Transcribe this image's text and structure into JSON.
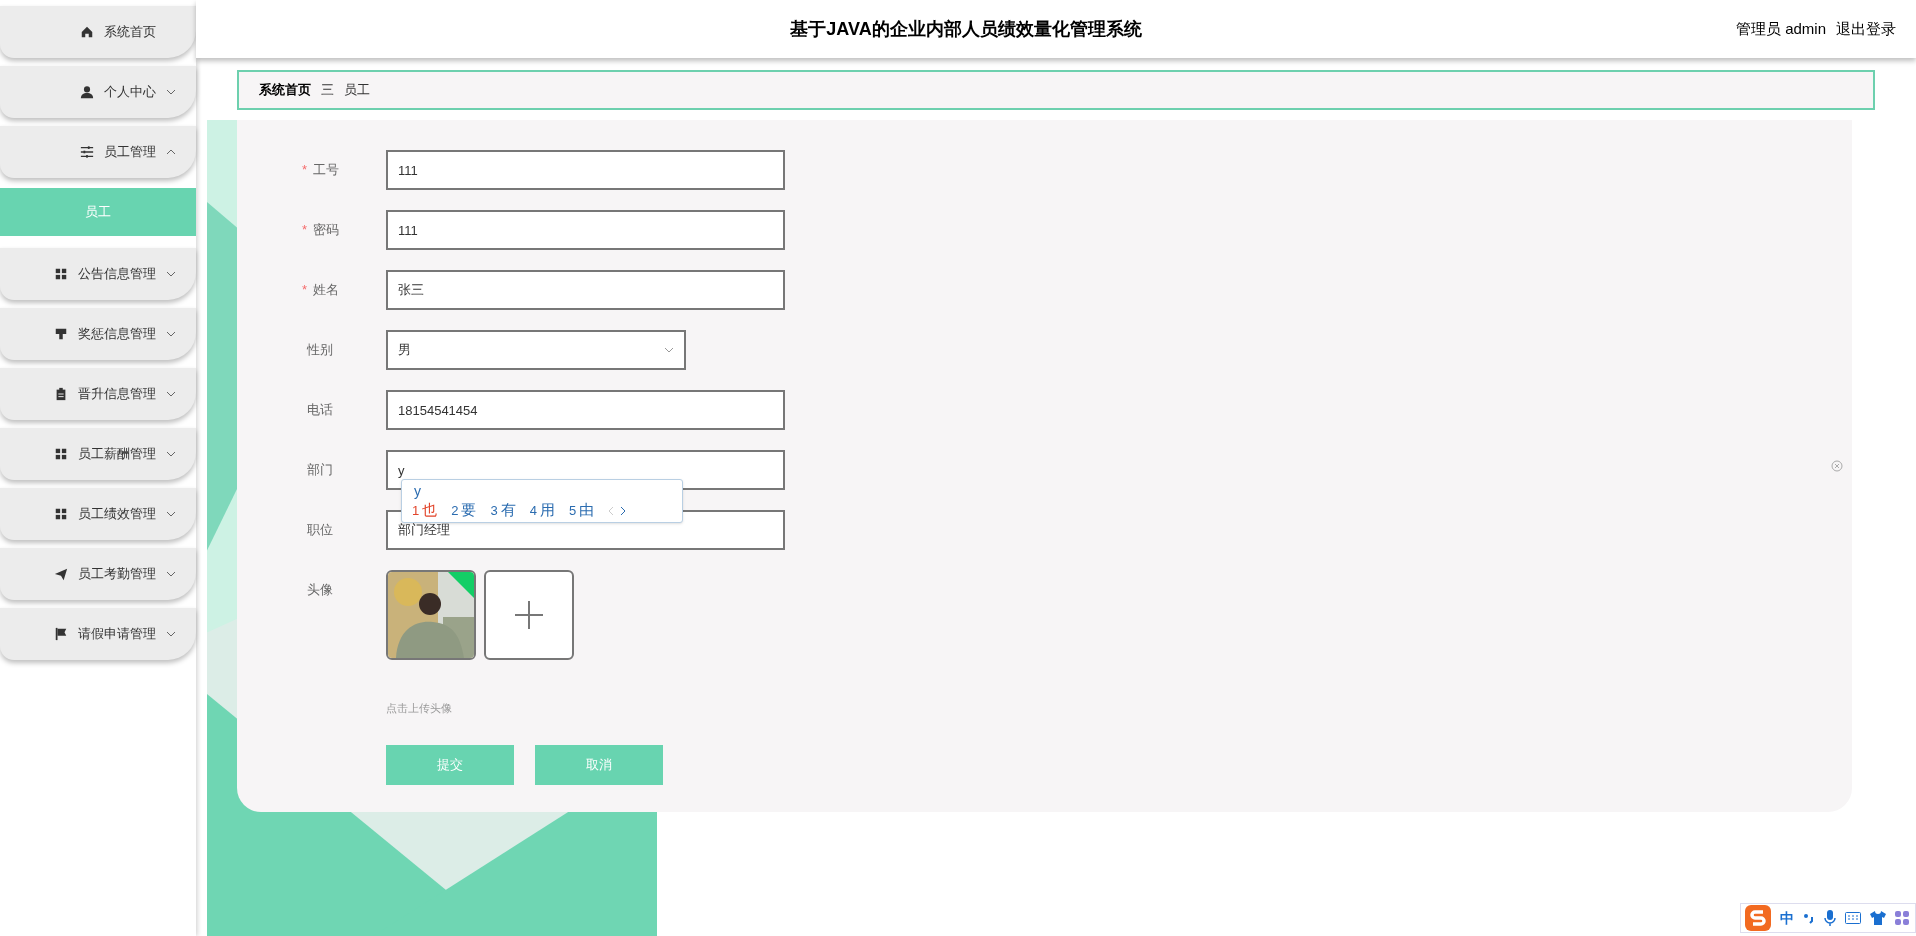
{
  "header": {
    "title": "基于JAVA的企业内部人员绩效量化管理系统",
    "user": "管理员 admin",
    "logout": "退出登录"
  },
  "sidebar": {
    "items": [
      {
        "label": "系统首页",
        "kind": "link"
      },
      {
        "label": "个人中心",
        "kind": "menu",
        "expanded": false
      },
      {
        "label": "员工管理",
        "kind": "menu",
        "expanded": true,
        "children": [
          {
            "label": "员工",
            "selected": true
          }
        ]
      },
      {
        "label": "公告信息管理",
        "kind": "menu",
        "expanded": false
      },
      {
        "label": "奖惩信息管理",
        "kind": "menu",
        "expanded": false
      },
      {
        "label": "晋升信息管理",
        "kind": "menu",
        "expanded": false
      },
      {
        "label": "员工薪酬管理",
        "kind": "menu",
        "expanded": false
      },
      {
        "label": "员工绩效管理",
        "kind": "menu",
        "expanded": false
      },
      {
        "label": "员工考勤管理",
        "kind": "menu",
        "expanded": false
      },
      {
        "label": "请假申请管理",
        "kind": "menu",
        "expanded": false
      }
    ]
  },
  "breadcrumb": {
    "items": [
      "系统首页",
      "员工"
    ],
    "separator": "三"
  },
  "form": {
    "fields": [
      {
        "label": "工号",
        "required_mark": "*",
        "kind": "input",
        "value": "111"
      },
      {
        "label": "密码",
        "required_mark": "*",
        "kind": "input",
        "value": "111"
      },
      {
        "label": "姓名",
        "required_mark": "*",
        "kind": "input",
        "value": "张三"
      },
      {
        "label": "性别",
        "kind": "select",
        "value": "男"
      },
      {
        "label": "电话",
        "kind": "input",
        "value": "18154541454"
      },
      {
        "label": "部门",
        "kind": "input",
        "value": "y"
      },
      {
        "label": "职位",
        "kind": "input",
        "value": "部门经理"
      },
      {
        "label": "头像",
        "kind": "upload",
        "hint": "点击上传头像"
      }
    ],
    "buttons": [
      "提交",
      "取消"
    ]
  },
  "ime": {
    "composition": "y",
    "candidates": [
      {
        "index": "1",
        "text": "也",
        "selected": true
      },
      {
        "index": "2",
        "text": "要",
        "selected": false
      },
      {
        "index": "3",
        "text": "有",
        "selected": false
      },
      {
        "index": "4",
        "text": "用",
        "selected": false
      },
      {
        "index": "5",
        "text": "由",
        "selected": false
      }
    ],
    "toolbar": {
      "mode": "中"
    }
  }
}
